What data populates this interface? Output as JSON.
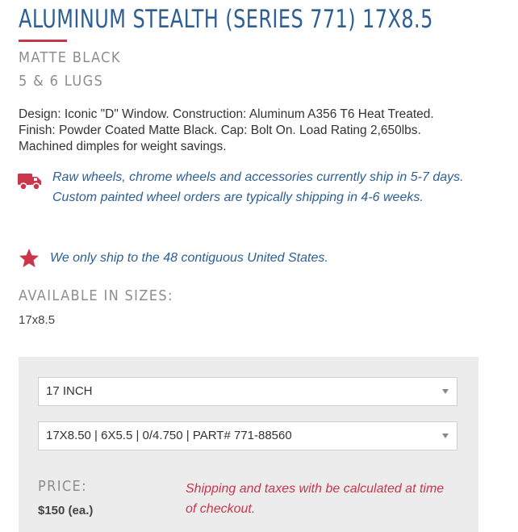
{
  "product": {
    "title": "ALUMINUM STEALTH (SERIES 771) 17X8.5",
    "finish": "MATTE BLACK",
    "lugs": "5 & 6 LUGS",
    "description": "Design: Iconic \"D\" Window. Construction: Aluminum A356 T6 Heat Treated. Finish: Powder Coated Matte Black. Cap: Bolt On. Load Rating 2,650lbs. Machined dimples for weight savings."
  },
  "notices": {
    "shipping_time": "Raw wheels, chrome wheels and accessories currently ship in 5-7 days. Custom painted wheel orders are typically shipping in 4-6 weeks.",
    "shipping_region": "We only ship to the 48 contiguous United States."
  },
  "sizes": {
    "label": "AVAILABLE IN SIZES:",
    "value": "17x8.5"
  },
  "order": {
    "size_select": {
      "selected": "17 INCH"
    },
    "part_select": {
      "selected": "17X8.50 | 6X5.5 | 0/4.750 | PART# 771-88560"
    },
    "price_label": "PRICE:",
    "price_value": "$150 (ea.)",
    "shipping_note": "Shipping and taxes with be calculated at time of checkout."
  },
  "icons": {
    "truck": "truck-icon",
    "star": "star-icon",
    "caret": "caret-down-icon"
  },
  "colors": {
    "title_blue": "#2e5f94",
    "accent_red": "#c9364a",
    "label_gray": "#8d8d8d",
    "panel_gray": "#ececec"
  }
}
